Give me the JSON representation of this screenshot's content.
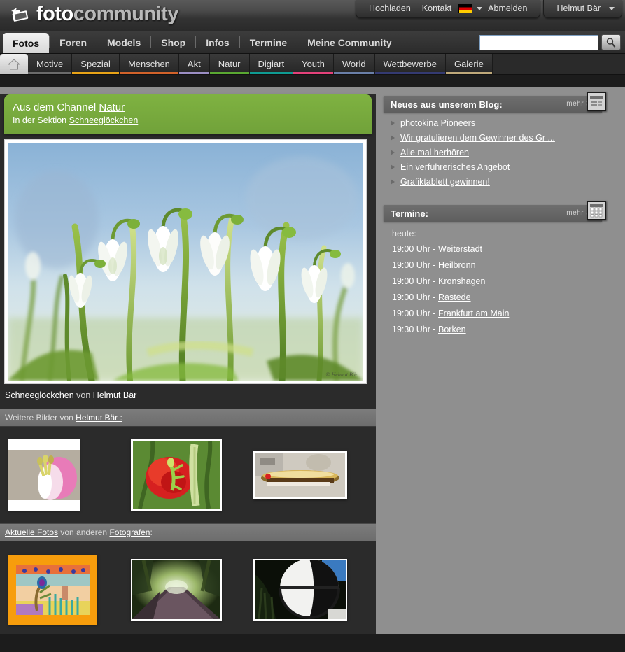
{
  "brand": {
    "foto": "foto",
    "community": "community",
    "icon": "camera-icon"
  },
  "topnav": {
    "items": [
      {
        "label": "Hochladen",
        "name": "hochladen"
      },
      {
        "label": "Kontakt",
        "name": "kontakt"
      }
    ],
    "flag": "german-flag-icon",
    "logout": "Abmelden",
    "user": "Helmut Bär"
  },
  "mainnav": {
    "tabs": [
      {
        "label": "Fotos",
        "active": true
      },
      {
        "label": "Foren",
        "active": false
      },
      {
        "label": "Models",
        "active": false
      },
      {
        "label": "Shop",
        "active": false
      },
      {
        "label": "Infos",
        "active": false
      },
      {
        "label": "Termine",
        "active": false
      },
      {
        "label": "Meine Community",
        "active": false
      }
    ]
  },
  "search": {
    "value": "",
    "placeholder": "",
    "icon": "search-icon"
  },
  "subnav": {
    "home_icon": "home-icon",
    "items": [
      {
        "label": "Motive",
        "color": "#6b6b6b"
      },
      {
        "label": "Spezial",
        "color": "#e8a317"
      },
      {
        "label": "Menschen",
        "color": "#d2622a"
      },
      {
        "label": "Akt",
        "color": "#9b8ec4"
      },
      {
        "label": "Natur",
        "color": "#5aa832"
      },
      {
        "label": "Digiart",
        "color": "#0f9b93"
      },
      {
        "label": "Youth",
        "color": "#e4417a"
      },
      {
        "label": "World",
        "color": "#6a7fa8"
      },
      {
        "label": "Wettbewerbe",
        "color": "#343a72"
      },
      {
        "label": "Galerie",
        "color": "#bfa97a"
      }
    ]
  },
  "channel": {
    "line1_prefix": "Aus dem Channel ",
    "line1_link": "Natur",
    "line2_prefix": "In der Sektion ",
    "line2_link": "Schneeglöckchen",
    "color": "#7fb241"
  },
  "photo": {
    "alt": "Schneeglöckchen",
    "watermark": "© Helmut Bär",
    "caption_link": "Schneeglöckchen",
    "caption_mid": " von ",
    "caption_author": "Helmut Bär"
  },
  "more_by_author": {
    "prefix": "Weitere Bilder von ",
    "link": "Helmut Bär :",
    "thumbs": [
      {
        "name": "thumb-pink-flower"
      },
      {
        "name": "thumb-red-poppy"
      },
      {
        "name": "thumb-brass-object"
      }
    ]
  },
  "recent_photos": {
    "link1": "Aktuelle Fotos",
    "mid": " von anderen ",
    "link2": "Fotografen",
    "suffix": ":",
    "thumbs": [
      {
        "name": "thumb-digiart-peacock"
      },
      {
        "name": "thumb-forest-road"
      },
      {
        "name": "thumb-white-sphere"
      }
    ]
  },
  "blog": {
    "title": "Neues aus unserem Blog:",
    "more": "mehr >>",
    "icon": "newspaper-icon",
    "items": [
      "photokina Pioneers",
      "Wir gratulieren dem Gewinner des Gr ...",
      "Alle mal herhören",
      "Ein verführerisches Angebot",
      "Grafiktablett gewinnen!"
    ]
  },
  "termine": {
    "title": "Termine:",
    "more": "mehr >>",
    "icon": "calendar-icon",
    "today_label": "heute:",
    "events": [
      {
        "time": "19:00 Uhr - ",
        "place": "Weiterstadt"
      },
      {
        "time": "19:00 Uhr - ",
        "place": "Heilbronn"
      },
      {
        "time": "19:00 Uhr - ",
        "place": "Kronshagen"
      },
      {
        "time": "19:00 Uhr - ",
        "place": "Rastede"
      },
      {
        "time": "19:00 Uhr - ",
        "place": "Frankfurt am Main"
      },
      {
        "time": "19:30 Uhr - ",
        "place": "Borken"
      }
    ]
  }
}
